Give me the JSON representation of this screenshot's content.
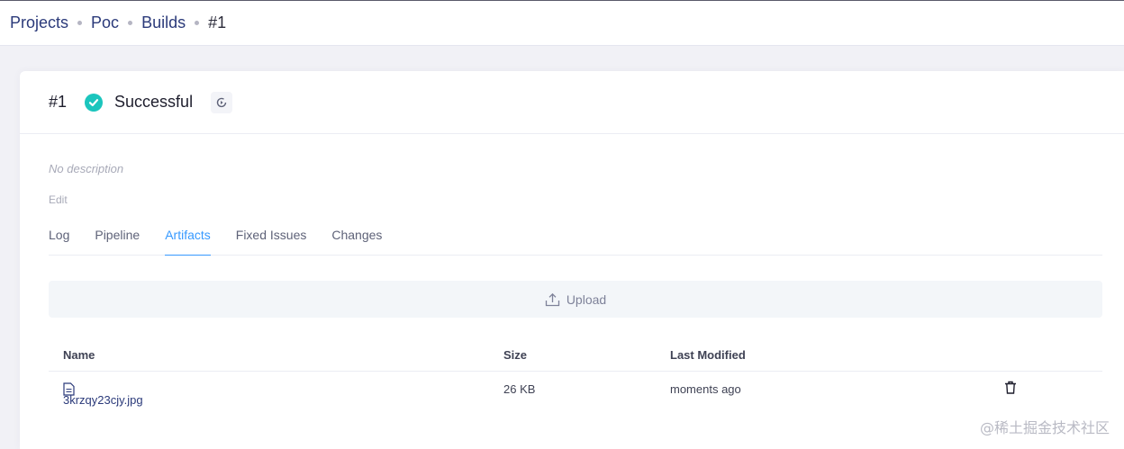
{
  "breadcrumb": {
    "items": [
      "Projects",
      "Poc",
      "Builds",
      "#1"
    ]
  },
  "build": {
    "number": "#1",
    "status": "Successful",
    "status_color": "#1bc5bd",
    "description": "No description",
    "edit_label": "Edit"
  },
  "tabs": [
    {
      "label": "Log",
      "active": false
    },
    {
      "label": "Pipeline",
      "active": false
    },
    {
      "label": "Artifacts",
      "active": true
    },
    {
      "label": "Fixed Issues",
      "active": false
    },
    {
      "label": "Changes",
      "active": false
    }
  ],
  "upload": {
    "label": "Upload",
    "icon": "upload-icon"
  },
  "artifacts": {
    "columns": [
      "Name",
      "Size",
      "Last Modified"
    ],
    "rows": [
      {
        "name": "3krzqy23cjy.jpg",
        "size": "26 KB",
        "modified": "moments ago",
        "icon": "file-icon",
        "action_icon": "trash-icon"
      }
    ]
  },
  "watermark": "@稀土掘金技术社区",
  "colors": {
    "accent": "#3699ff",
    "link": "#2b3a7a",
    "success": "#1bc5bd"
  }
}
